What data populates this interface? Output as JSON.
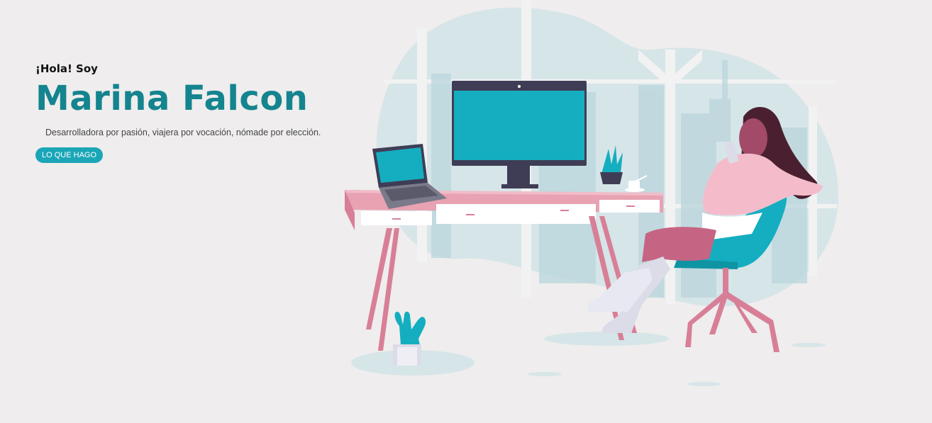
{
  "hero": {
    "greeting": "¡Hola! Soy",
    "name": "Marina Falcon",
    "tagline": "Desarrolladora por pasión, viajera por vocación, nómade por elección.",
    "cta_label": "LO QUE HAGO"
  },
  "colors": {
    "background": "#efeded",
    "accent": "#14848f",
    "button": "#1ba6b8"
  }
}
